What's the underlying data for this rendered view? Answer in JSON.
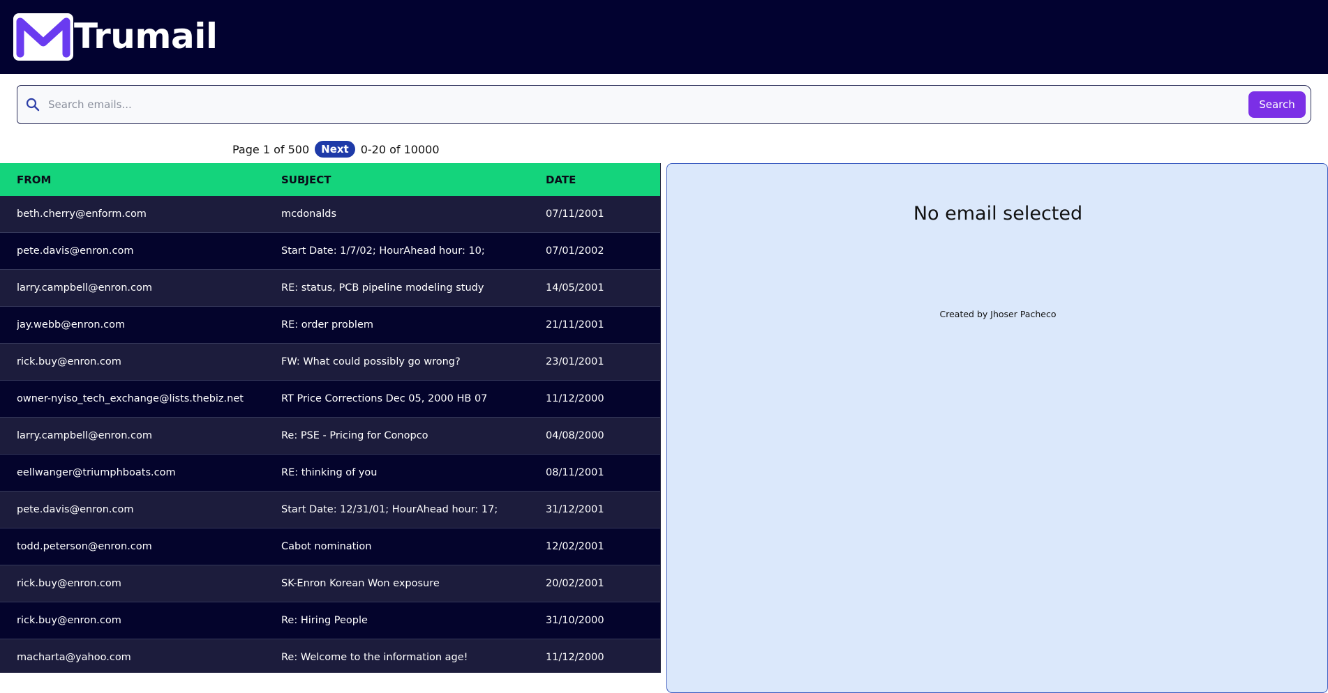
{
  "app": {
    "name": "Trumail",
    "icon": "envelope-m-logo",
    "colors": {
      "header": "#020230",
      "accent": "#7b2fe6",
      "table_header": "#14d47c",
      "preview_bg": "#dbe8fb"
    }
  },
  "search": {
    "placeholder": "Search emails...",
    "value": "",
    "button_label": "Search",
    "icon": "search-icon"
  },
  "pagination": {
    "page_text": "Page 1 of 500",
    "next_label": "Next",
    "range_text": "0-20 of 10000"
  },
  "table": {
    "columns": [
      "FROM",
      "SUBJECT",
      "DATE"
    ],
    "rows": [
      {
        "from": "beth.cherry@enform.com",
        "subject": "mcdonalds",
        "date": "07/11/2001"
      },
      {
        "from": "pete.davis@enron.com",
        "subject": "Start Date: 1/7/02; HourAhead hour: 10;",
        "date": "07/01/2002"
      },
      {
        "from": "larry.campbell@enron.com",
        "subject": "RE: status, PCB pipeline modeling study",
        "date": "14/05/2001"
      },
      {
        "from": "jay.webb@enron.com",
        "subject": "RE: order problem",
        "date": "21/11/2001"
      },
      {
        "from": "rick.buy@enron.com",
        "subject": "FW: What could possibly go wrong?",
        "date": "23/01/2001"
      },
      {
        "from": "owner-nyiso_tech_exchange@lists.thebiz.net",
        "subject": "RT Price Corrections Dec 05, 2000 HB 07",
        "date": "11/12/2000"
      },
      {
        "from": "larry.campbell@enron.com",
        "subject": "Re: PSE - Pricing for Conopco",
        "date": "04/08/2000"
      },
      {
        "from": "eellwanger@triumphboats.com",
        "subject": "RE: thinking of you",
        "date": "08/11/2001"
      },
      {
        "from": "pete.davis@enron.com",
        "subject": "Start Date: 12/31/01; HourAhead hour: 17;",
        "date": "31/12/2001"
      },
      {
        "from": "todd.peterson@enron.com",
        "subject": "Cabot nomination",
        "date": "12/02/2001"
      },
      {
        "from": "rick.buy@enron.com",
        "subject": "SK-Enron Korean Won exposure",
        "date": "20/02/2001"
      },
      {
        "from": "rick.buy@enron.com",
        "subject": "Re: Hiring People",
        "date": "31/10/2000"
      },
      {
        "from": "macharta@yahoo.com",
        "subject": "Re: Welcome to the information age!",
        "date": "11/12/2000"
      }
    ]
  },
  "preview": {
    "empty_text": "No email selected",
    "credit": "Created by Jhoser Pacheco"
  }
}
